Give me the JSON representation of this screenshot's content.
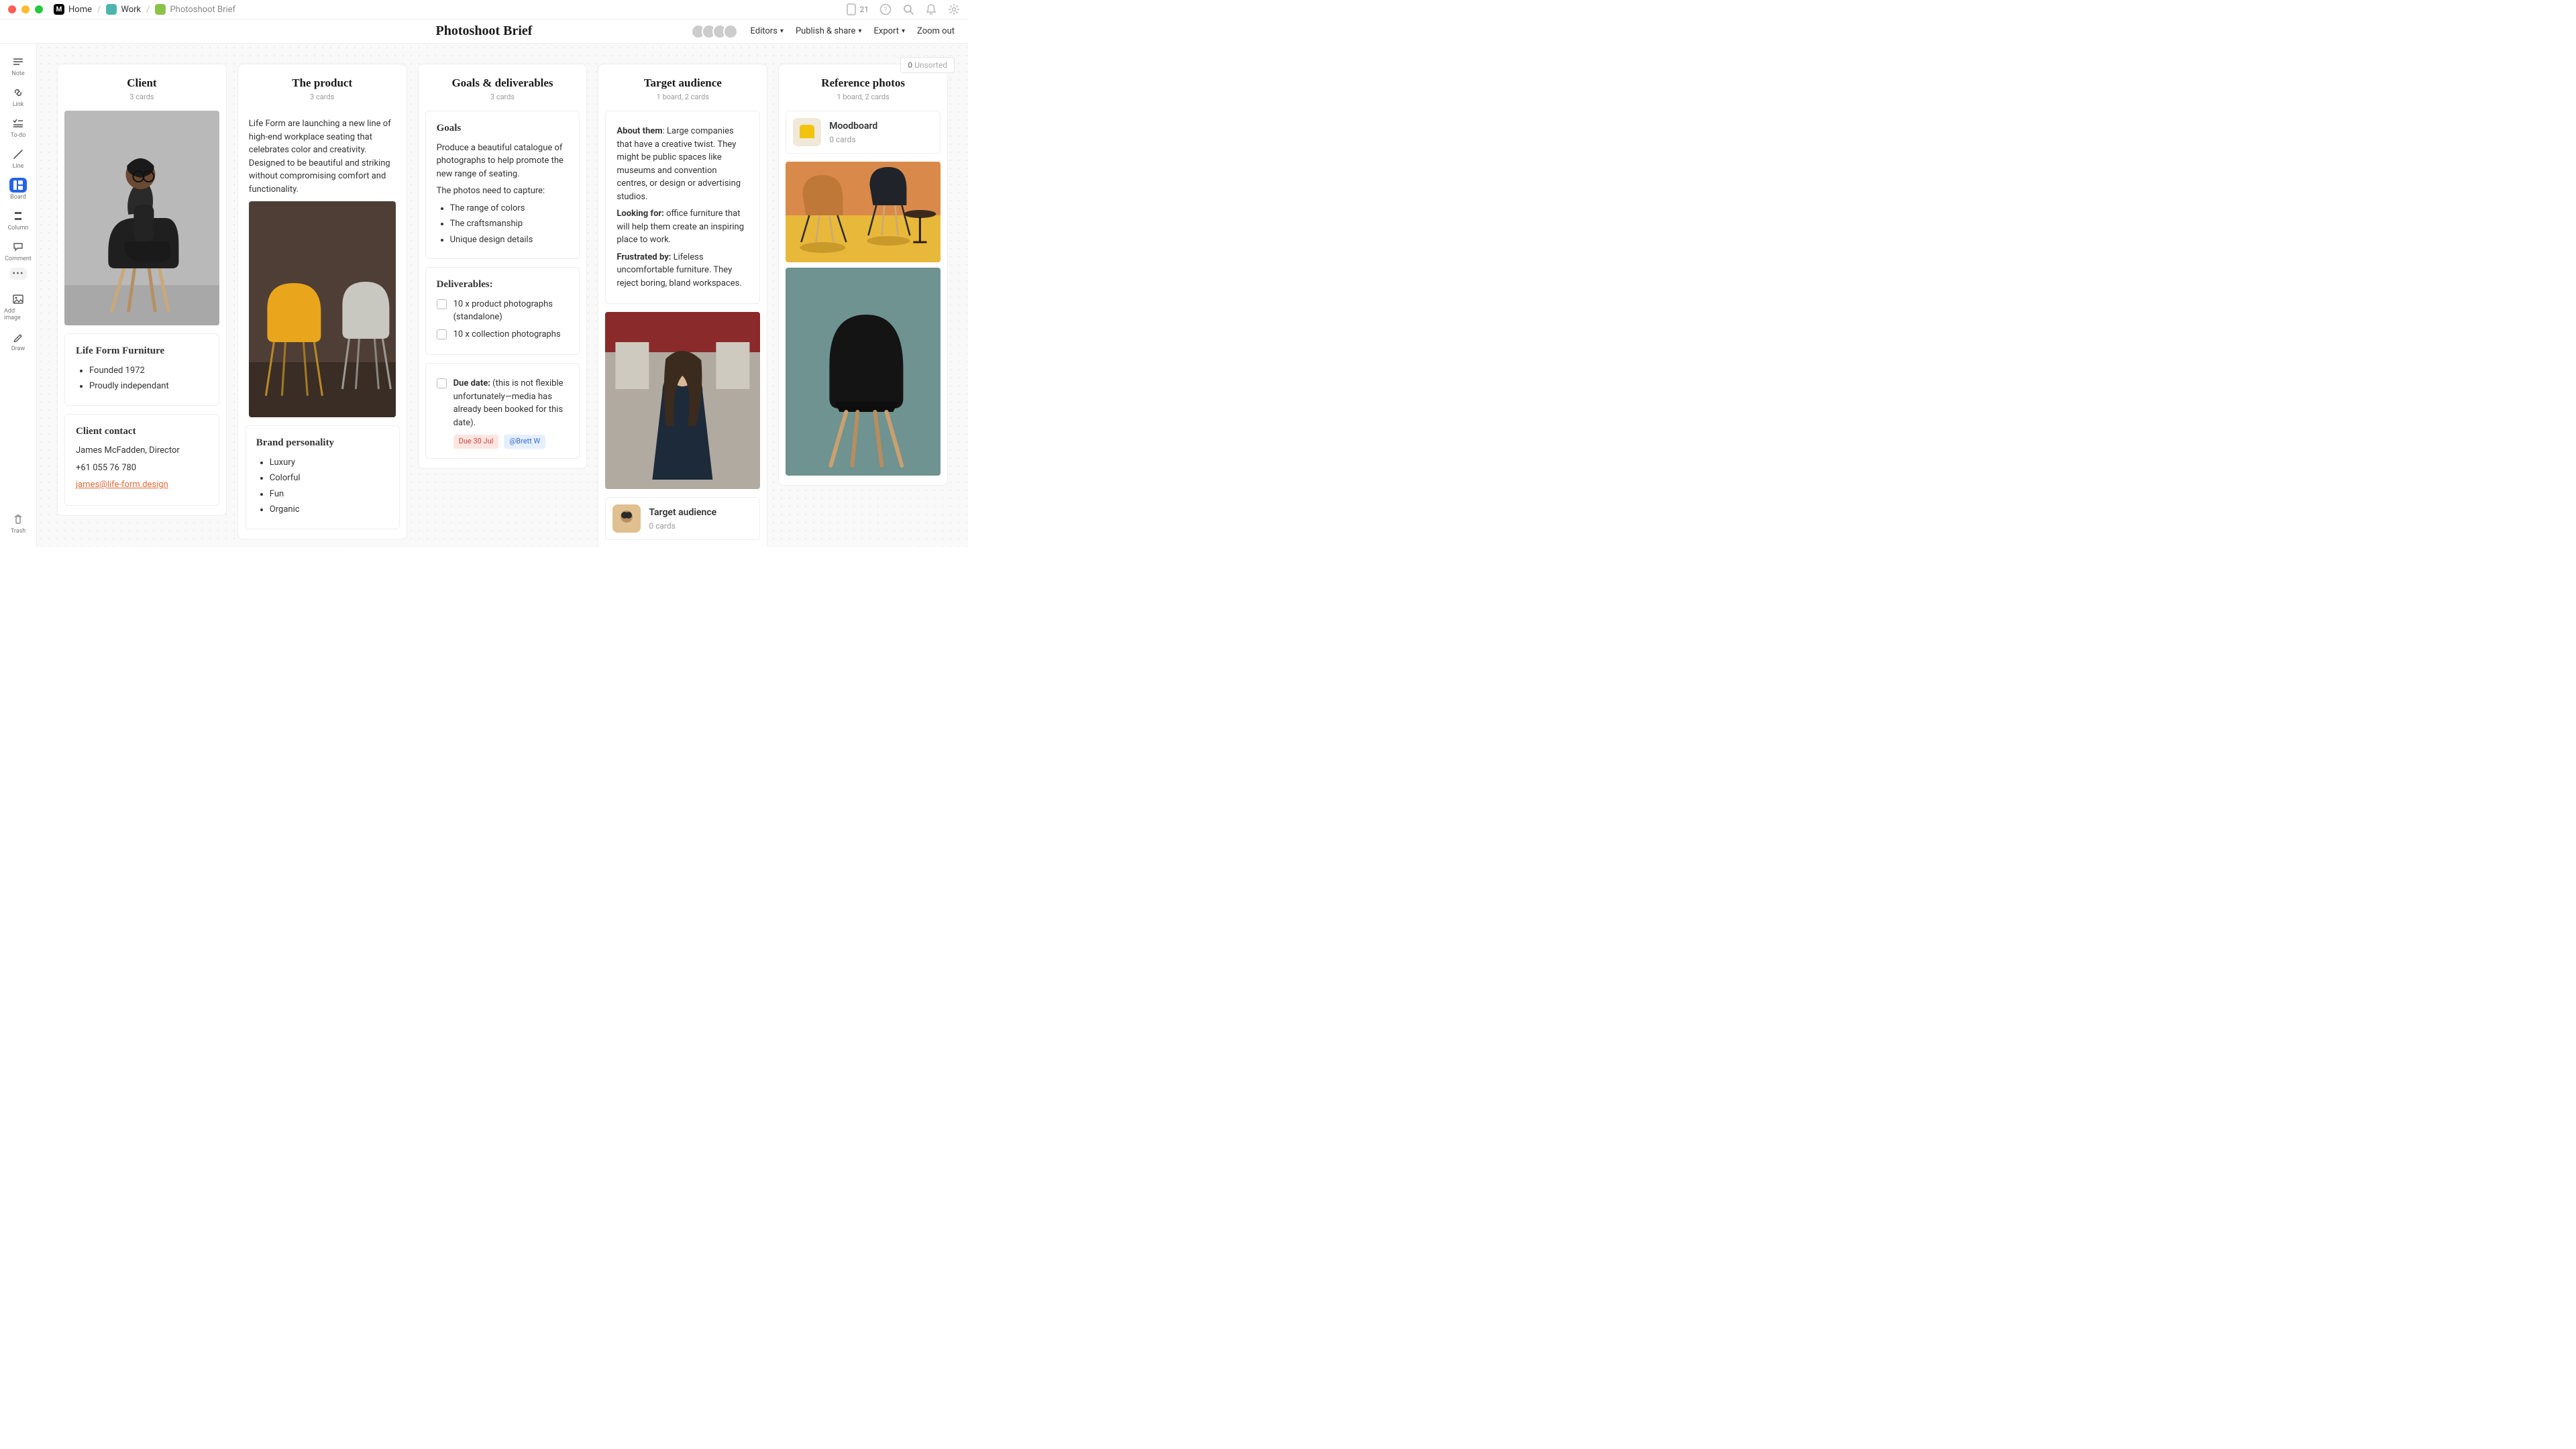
{
  "breadcrumb": {
    "home": "Home",
    "work": "Work",
    "current": "Photoshoot Brief"
  },
  "titlebar": {
    "device_count": "21"
  },
  "header": {
    "title": "Photoshoot Brief",
    "editors": "Editors",
    "publish": "Publish & share",
    "export": "Export",
    "zoom_out": "Zoom out"
  },
  "rail": {
    "note": "Note",
    "link": "Link",
    "todo": "To-do",
    "line": "Line",
    "board": "Board",
    "column": "Column",
    "comment": "Comment",
    "addimage": "Add image",
    "draw": "Draw",
    "trash": "Trash"
  },
  "unsorted": {
    "count": "0",
    "label": "Unsorted"
  },
  "columns": {
    "client": {
      "title": "Client",
      "sub": "3 cards",
      "company_heading": "Life Form Furniture",
      "bullets": [
        "Founded 1972",
        "Proudly independant"
      ],
      "contact_heading": "Client contact",
      "contact_name": "James McFadden, Director",
      "contact_phone": "+61 055 76 780",
      "contact_email": "james@life-form.design"
    },
    "product": {
      "title": "The product",
      "sub": "3 cards",
      "blurb": "Life Form are launching a new line of high-end workplace seating that celebrates color and creativity. Designed to be beautiful and striking without compromising comfort and functionality.",
      "brand_heading": "Brand personality",
      "brand_bullets": [
        "Luxury",
        "Colorful",
        "Fun",
        "Organic"
      ]
    },
    "goals": {
      "title": "Goals & deliverables",
      "sub": "3 cards",
      "goals_heading": "Goals",
      "goals_p1": "Produce a beautiful catalogue of photographs to help promote the new range of seating.",
      "goals_p2": "The photos need to capture:",
      "goals_bullets": [
        "The range of colors",
        "The craftsmanship",
        "Unique design details"
      ],
      "deliv_heading": "Deliverables:",
      "deliv_items": [
        "10 x product photographs (standalone)",
        "10 x collection photographs"
      ],
      "due_label": "Due date:",
      "due_text": " (this is not flexible unfortunately—media has already been booked for this date).",
      "chip_due": "Due 30 Jul",
      "chip_mention": "@Brett W"
    },
    "audience": {
      "title": "Target audience",
      "sub": "1 board, 2 cards",
      "about_label": "About them",
      "about_text": ": Large companies that have a creative twist. They might be public spaces like museums and convention centres, or design or advertising studios.",
      "looking_label": "Looking for:",
      "looking_text": " office furniture that will help them create an inspiring place to work.",
      "frustrated_label": "Frustrated by:",
      "frustrated_text": " Lifeless uncomfortable furniture. They reject boring, bland workspaces.",
      "board_title": "Target audience",
      "board_sub": "0 cards"
    },
    "reference": {
      "title": "Reference photos",
      "sub": "1 board, 2 cards",
      "mood_title": "Moodboard",
      "mood_sub": "0 cards"
    }
  }
}
